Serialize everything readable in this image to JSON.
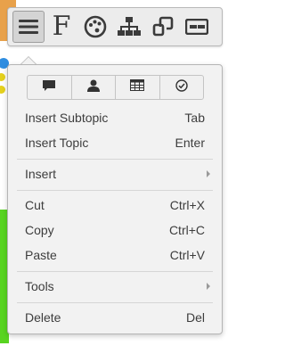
{
  "toolbar": {
    "buttons": [
      {
        "icon": "hamburger-menu-icon",
        "active": true
      },
      {
        "icon": "font-icon",
        "glyph": "F"
      },
      {
        "icon": "palette-icon"
      },
      {
        "icon": "structure-icon"
      },
      {
        "icon": "link-icon"
      },
      {
        "icon": "label-icon"
      }
    ]
  },
  "menu": {
    "quick_actions": [
      {
        "icon": "comment-icon"
      },
      {
        "icon": "user-icon"
      },
      {
        "icon": "table-icon"
      },
      {
        "icon": "check-circle-icon"
      }
    ],
    "insert_subtopic": {
      "label": "Insert Subtopic",
      "shortcut": "Tab"
    },
    "insert_topic": {
      "label": "Insert Topic",
      "shortcut": "Enter"
    },
    "insert": {
      "label": "Insert"
    },
    "cut": {
      "label": "Cut",
      "shortcut": "Ctrl+X"
    },
    "copy": {
      "label": "Copy",
      "shortcut": "Ctrl+C"
    },
    "paste": {
      "label": "Paste",
      "shortcut": "Ctrl+V"
    },
    "tools": {
      "label": "Tools"
    },
    "delete": {
      "label": "Delete",
      "shortcut": "Del"
    }
  },
  "colors": {
    "menu_bg": "#f2f2f2",
    "text": "#3d3d3d",
    "background_accent_orange": "#e8a14a",
    "background_accent_green": "#58d421",
    "background_accent_blue": "#2f8de0"
  }
}
